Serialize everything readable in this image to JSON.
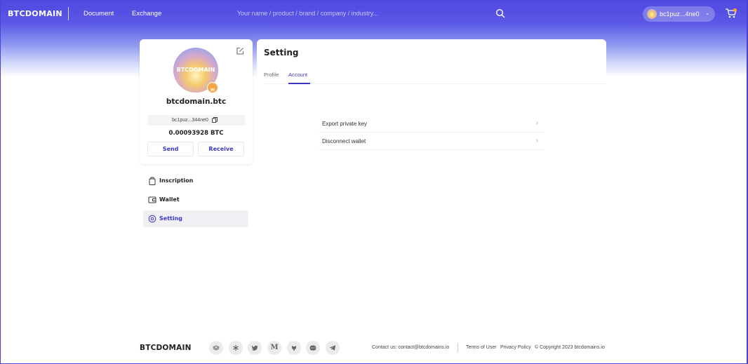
{
  "header": {
    "logo": "BTCDOMAIN",
    "nav": [
      "Document",
      "Exchange"
    ],
    "search": {
      "placeholder": "Your name / product / brand / company / industry...",
      "value": ""
    },
    "wallet": {
      "address": "bc1puz...4ne0"
    },
    "icons": {
      "search": "search-icon",
      "cart": "cart-icon",
      "chevron": "chevron-down-icon"
    }
  },
  "profile": {
    "avatar_text": "BTCDOMAIN",
    "badge_text": "99",
    "domain": "btcdomain.btc",
    "address": "bc1puz...344ne0",
    "balance": "0.00093928 BTC",
    "send_label": "Send",
    "receive_label": "Receive"
  },
  "menu": [
    {
      "label": "Inscription",
      "icon": "inscription-icon",
      "active": false
    },
    {
      "label": "Wallet",
      "icon": "wallet-icon",
      "active": false
    },
    {
      "label": "Setting",
      "icon": "setting-icon",
      "active": true
    }
  ],
  "settings": {
    "title": "Setting",
    "tabs": [
      {
        "label": "Profile",
        "active": false
      },
      {
        "label": "Account",
        "active": true
      }
    ],
    "rows": [
      "Export private key",
      "Disconnect wallet"
    ]
  },
  "footer": {
    "logo": "BTCDOMAIN",
    "socials": [
      "gitbook-icon",
      "linktree-icon",
      "twitter-icon",
      "medium-icon",
      "github-icon",
      "discord-icon",
      "telegram-icon"
    ],
    "contact": "Contact us: contact@btcdomains.io",
    "terms": "Terms of User",
    "privacy": "Privacy Policy",
    "copyright": "© Copyright 2023 btcdomains.io"
  },
  "colors": {
    "accent": "#3b37c6",
    "header": "#5048e0",
    "badge": "#f4a64b"
  }
}
